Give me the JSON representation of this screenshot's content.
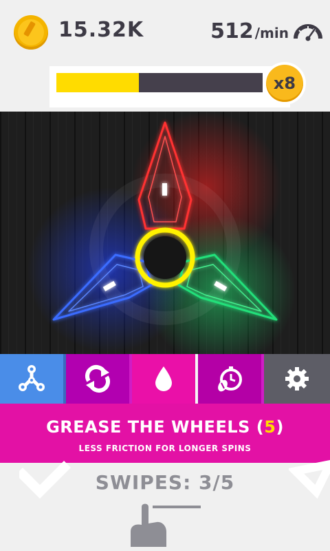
{
  "header": {
    "coins": "15.32K",
    "rate_value": "512",
    "rate_unit": "/min"
  },
  "progress": {
    "fraction": 0.4,
    "multiplier": "x8"
  },
  "spinner": {
    "colors": [
      "#ff2a2a",
      "#2a6cff",
      "#22e07a",
      "#fff200"
    ]
  },
  "tabs": [
    {
      "icon": "fidget-spinner-icon",
      "active": true
    },
    {
      "icon": "refresh-icon",
      "active": false
    },
    {
      "icon": "oil-drop-icon",
      "active": false
    },
    {
      "icon": "timer-boost-icon",
      "active": false
    },
    {
      "icon": "gear-icon",
      "active": false
    }
  ],
  "upgrade": {
    "title_prefix": "GREASE THE WHEELS (",
    "count": "5",
    "title_suffix": ")",
    "description": "LESS FRICTION FOR LONGER SPINS"
  },
  "tutorial": {
    "swipes_text": "SWIPES: 3/5"
  }
}
